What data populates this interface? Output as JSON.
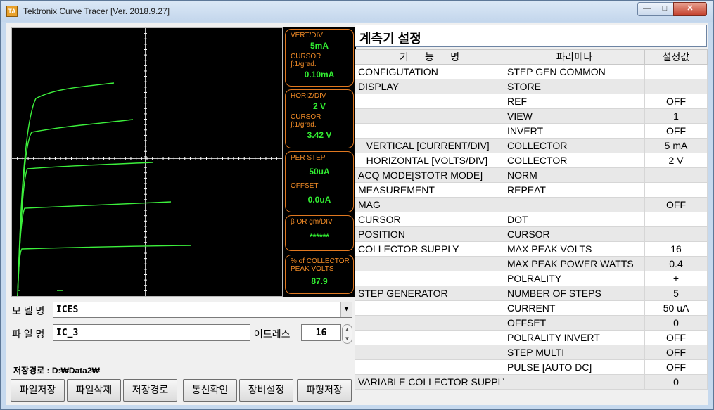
{
  "window": {
    "title": "Tektronix Curve Tracer [Ver. 2018.9.27]",
    "icon_text": "TA",
    "min_glyph": "—",
    "max_glyph": "□",
    "close_glyph": "✕"
  },
  "scope": {
    "vert_label": "VERT/DIV",
    "vert_value": "5mA",
    "vert_cursor_label": "CURSOR\n∫:1/grad.",
    "vert_cursor_value": "0.10mA",
    "horiz_label": "HORIZ/DIV",
    "horiz_value": "2 V",
    "horiz_cursor_label": "CURSOR\n∫:1/grad.",
    "horiz_cursor_value": "3.42 V",
    "per_step_label": "PER STEP",
    "per_step_value": "50uA",
    "offset_label": "OFFSET",
    "offset_value": "0.0uA",
    "beta_label": "β OR gm/DIV",
    "beta_value": "******",
    "pct_label": "% of COLLECTOR\nPEAK VOLTS",
    "pct_value": "87.9"
  },
  "form": {
    "model_label": "모 델 명",
    "model_value": "ICES",
    "file_label": "파 일 명",
    "file_value": "IC_3",
    "address_label": "어드레스",
    "address_value": "16",
    "save_path_label": "저장경로 :",
    "save_path_value": "D:₩Data2₩"
  },
  "buttons": {
    "save_file": "파일저장",
    "delete_file": "파일삭제",
    "save_path": "저장경로",
    "comm_check": "통신확인",
    "device_settings": "장비설정",
    "waveform_save": "파형저장"
  },
  "settings": {
    "title": "계측기 설정",
    "headers": [
      "기      능      명",
      "파라메타",
      "설정값"
    ],
    "rows": [
      [
        "CONFIGUTATION",
        "STEP GEN     COMMON",
        ""
      ],
      [
        "DISPLAY",
        "STORE",
        ""
      ],
      [
        "",
        "REF",
        "OFF"
      ],
      [
        "",
        "VIEW",
        "1"
      ],
      [
        "",
        "INVERT",
        "OFF"
      ],
      [
        "   VERTICAL [CURRENT/DIV]",
        "COLLECTOR",
        "5 mA"
      ],
      [
        "   HORIZONTAL [VOLTS/DIV]",
        "COLLECTOR",
        "2 V"
      ],
      [
        "ACQ MODE[STOTR MODE]",
        "NORM",
        ""
      ],
      [
        "MEASUREMENT",
        "REPEAT",
        ""
      ],
      [
        "MAG",
        "",
        "OFF"
      ],
      [
        "CURSOR",
        "DOT",
        ""
      ],
      [
        "POSITION",
        "CURSOR",
        ""
      ],
      [
        "COLLECTOR SUPPLY",
        "MAX PEAK VOLTS",
        "16"
      ],
      [
        "",
        "MAX PEAK POWER WATTS",
        "0.4"
      ],
      [
        "",
        "POLRALITY",
        "+"
      ],
      [
        "STEP GENERATOR",
        "NUMBER OF STEPS",
        "5"
      ],
      [
        "",
        "CURRENT",
        "50 uA"
      ],
      [
        "",
        "OFFSET",
        "0"
      ],
      [
        "",
        "POLRALITY INVERT",
        "OFF"
      ],
      [
        "",
        "STEP MULTI",
        "OFF"
      ],
      [
        "",
        "PULSE [AUTO DC]",
        "OFF"
      ],
      [
        "VARIABLE COLLECTOR SUPPLY",
        "",
        "0"
      ]
    ]
  },
  "colors": {
    "trace": "#3cf03c",
    "grid": "#ffffff",
    "panel_text": "#f08a26",
    "panel_value": "#32ef32"
  }
}
